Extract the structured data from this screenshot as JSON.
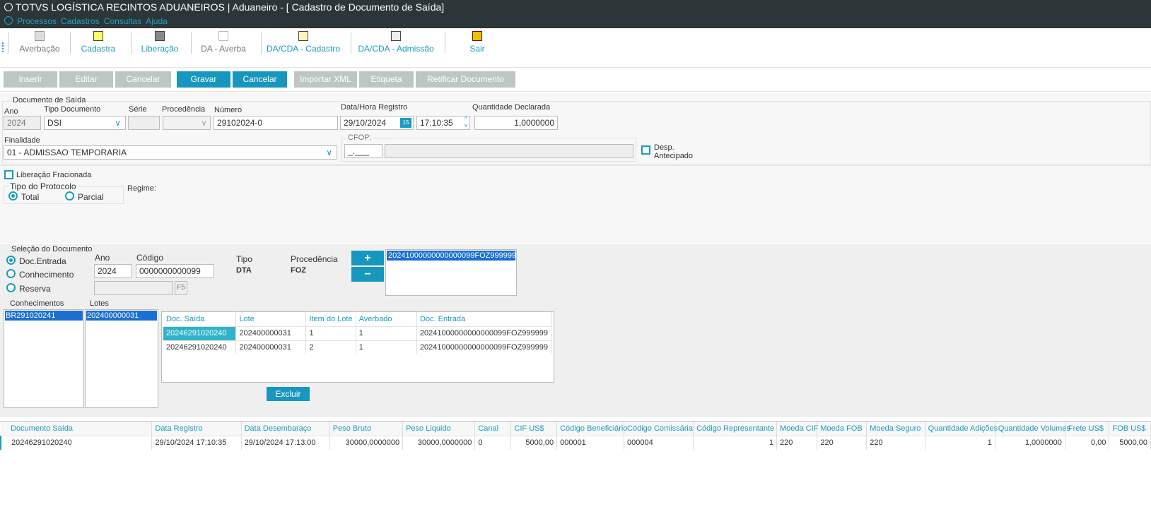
{
  "window": {
    "title": "TOTVS LOGÍSTICA RECINTOS ADUANEIROS | Aduaneiro - [ Cadastro de Documento de Saída]"
  },
  "menu": [
    "Processos",
    "Cadastros",
    "Consultas",
    "Ajuda"
  ],
  "toolbar": [
    {
      "label": "Averbação",
      "icon": "printer-icon",
      "enabled": false
    },
    {
      "label": "Cadastra",
      "icon": "new-document-icon",
      "enabled": true
    },
    {
      "label": "Liberação",
      "icon": "release-icon",
      "enabled": true
    },
    {
      "label": "DA - Averba",
      "icon": "hand-icon",
      "enabled": false
    },
    {
      "label": "DA/CDA - Cadastro",
      "icon": "document-star-icon",
      "enabled": true
    },
    {
      "label": "DA/CDA - Admissão",
      "icon": "document-admission-icon",
      "enabled": true
    },
    {
      "label": "Sair",
      "icon": "exit-door-icon",
      "enabled": true
    }
  ],
  "actions": {
    "inserir": "Inserir",
    "editar": "Editar",
    "cancelar1": "Cancelar",
    "gravar": "Gravar",
    "cancelar2": "Cancelar",
    "importar": "Importar XML",
    "etiqueta": "Etiqueta",
    "retificar": "Retificar Documento"
  },
  "doc": {
    "group": "Documento de Saída",
    "ano_label": "Ano",
    "ano": "2024",
    "tipo_label": "Tipo Documento",
    "tipo": "DSI",
    "serie_label": "Série",
    "serie": "",
    "proc_label": "Procedência",
    "numero_label": "Número",
    "numero": "29102024-0",
    "data_label": "Data/Hora Registro",
    "data": "29/10/2024",
    "hora": "17:10:35",
    "qtd_label": "Quantidade Declarada",
    "qtd": "1,0000000",
    "finalidade_label": "Finalidade",
    "finalidade": "01 - ADMISSAO TEMPORARIA",
    "cfop_label": "CFOP:",
    "cfop": "_.___",
    "desp1": "Desp.",
    "desp2": "Antecipado",
    "lib_frac": "Liberação Fracionada",
    "protocolo_label": "Tipo do Protocolo",
    "total": "Total",
    "parcial": "Parcial",
    "regime": "Regime:"
  },
  "selecao": {
    "group": "Seleção do Documento",
    "opts": [
      "Doc.Entrada",
      "Conhecimento",
      "Reserva"
    ],
    "ano_label": "Ano",
    "ano": "2024",
    "codigo_label": "Código",
    "codigo": "0000000000099",
    "tipo_label": "Tipo",
    "tipo": "DTA",
    "proc_label": "Procedência",
    "proc": "FOZ",
    "f5": "F5",
    "list": [
      "20241000000000000099FOZ999999"
    ]
  },
  "conhecimentos": {
    "label": "Conhecimentos",
    "items": [
      "BR291020241"
    ]
  },
  "lotes": {
    "label": "Lotes",
    "items": [
      "202400000031"
    ]
  },
  "lotegrid": {
    "headers": [
      "Doc. Saída",
      "Lote",
      "Item do Lote",
      "Averbado",
      "Doc. Entrada"
    ],
    "rows": [
      [
        "20246291020240",
        "202400000031",
        "1",
        "1",
        "20241000000000000099FOZ999999"
      ],
      [
        "20246291020240",
        "202400000031",
        "2",
        "1",
        "20241000000000000099FOZ999999"
      ]
    ]
  },
  "excluir": "Excluir",
  "maingrid": {
    "headers": [
      "Documento Saída",
      "Data Registro",
      "Data  Desembaraço",
      "Peso Bruto",
      "Peso Liquido",
      "Canal",
      "CIF US$",
      "Código Beneficiário",
      "Código Comissária",
      "Código Representante",
      "Moeda CIF",
      "Moeda FOB",
      "Moeda Seguro",
      "Quantidade Adições",
      "Quantidade Volumes",
      "Frete US$",
      "FOB US$"
    ],
    "rows": [
      [
        "20246291020240",
        "29/10/2024 17:10:35",
        "29/10/2024 17:13:00",
        "30000,0000000",
        "30000,0000000",
        "0",
        "5000,00",
        "000001",
        "000004",
        "1",
        "220",
        "220",
        "220",
        "1",
        "1,0000000",
        "0,00",
        "5000,00"
      ]
    ]
  },
  "colors": {
    "accent": "#1797bd",
    "titlebar": "#2c3538"
  }
}
